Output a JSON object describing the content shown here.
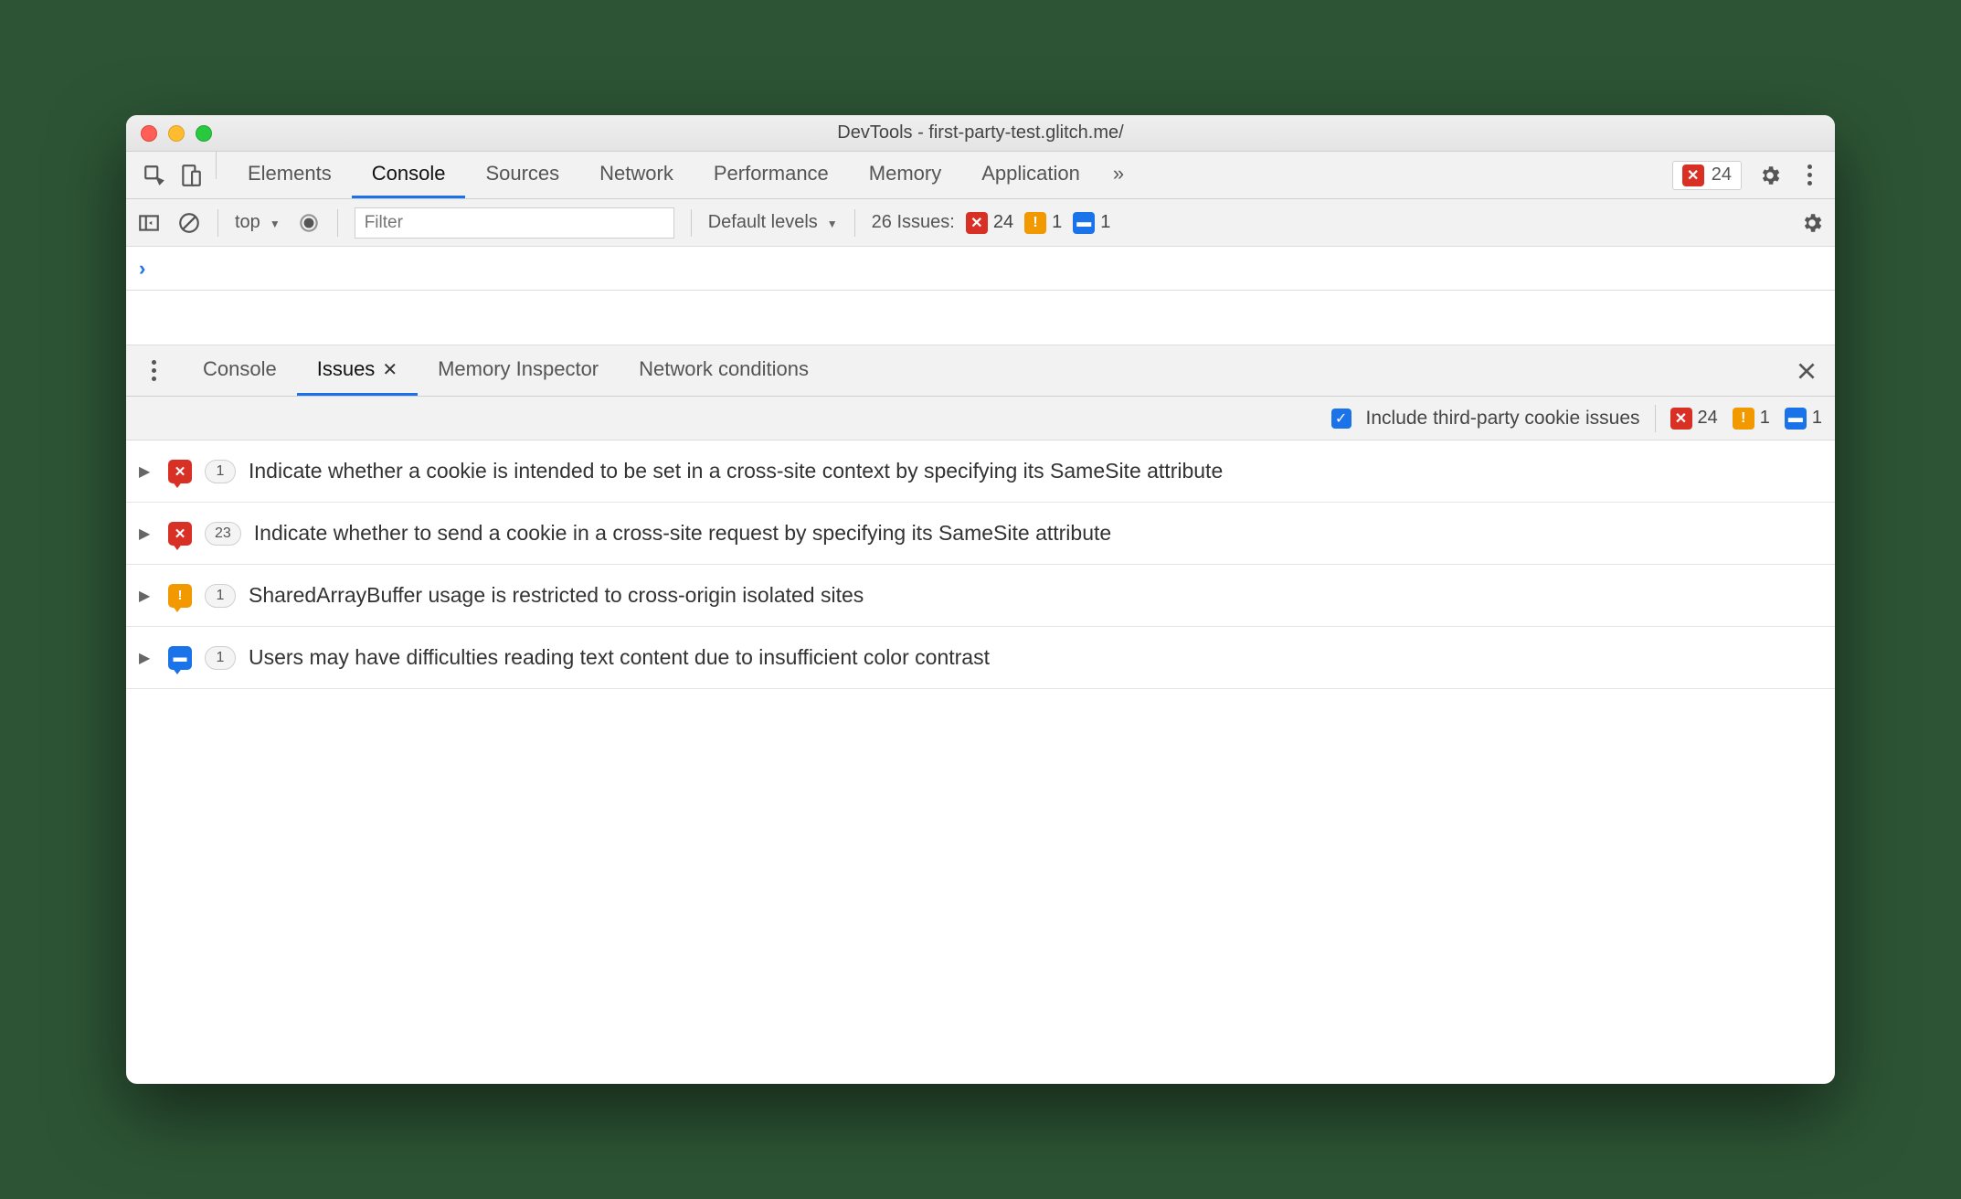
{
  "window": {
    "title": "DevTools - first-party-test.glitch.me/"
  },
  "mainTabs": {
    "items": [
      {
        "label": "Elements"
      },
      {
        "label": "Console"
      },
      {
        "label": "Sources"
      },
      {
        "label": "Network"
      },
      {
        "label": "Performance"
      },
      {
        "label": "Memory"
      },
      {
        "label": "Application"
      }
    ],
    "activeIndex": 1,
    "overflowGlyph": "»"
  },
  "mainBadge": {
    "errorCount": "24"
  },
  "consoleToolbar": {
    "contextLabel": "top",
    "filterPlaceholder": "Filter",
    "levelsLabel": "Default levels",
    "issuesPrefix": "26 Issues:",
    "errorCount": "24",
    "warnCount": "1",
    "infoCount": "1"
  },
  "prompt": {
    "glyph": "›"
  },
  "drawerTabs": {
    "items": [
      {
        "label": "Console"
      },
      {
        "label": "Issues"
      },
      {
        "label": "Memory Inspector"
      },
      {
        "label": "Network conditions"
      }
    ],
    "activeIndex": 1
  },
  "issuesToolbar": {
    "checkboxLabel": "Include third-party cookie issues",
    "checkboxChecked": true,
    "errorCount": "24",
    "warnCount": "1",
    "infoCount": "1"
  },
  "issues": [
    {
      "kind": "red",
      "count": "1",
      "title": "Indicate whether a cookie is intended to be set in a cross-site context by specifying its SameSite attribute"
    },
    {
      "kind": "red",
      "count": "23",
      "title": "Indicate whether to send a cookie in a cross-site request by specifying its SameSite attribute"
    },
    {
      "kind": "yellow",
      "count": "1",
      "title": "SharedArrayBuffer usage is restricted to cross-origin isolated sites"
    },
    {
      "kind": "blue",
      "count": "1",
      "title": "Users may have difficulties reading text content due to insufficient color contrast"
    }
  ]
}
